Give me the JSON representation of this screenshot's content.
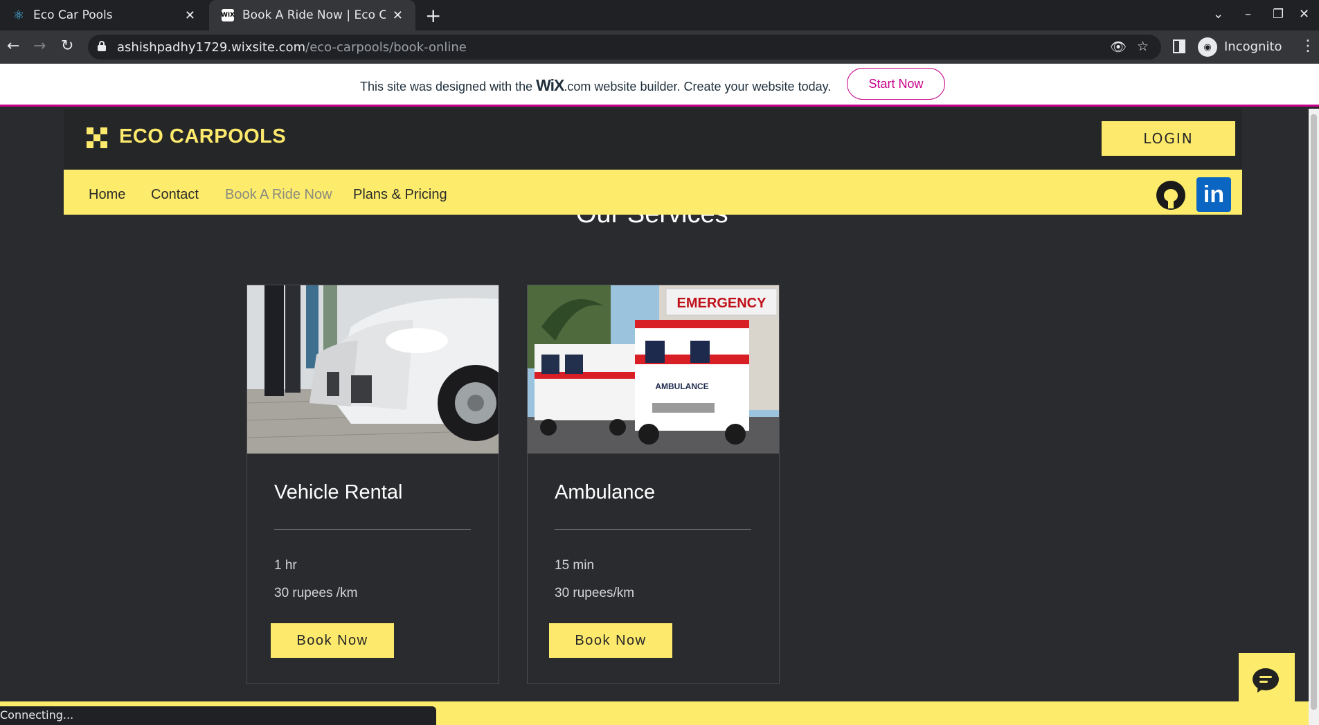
{
  "browser": {
    "tabs": [
      {
        "title": "Eco Car Pools",
        "icon": "react-icon"
      },
      {
        "title": "Book A Ride Now | Eco Car",
        "icon": "wix-icon",
        "icon_text": "WiX"
      }
    ],
    "url_host": "ashishpadhy1729.wixsite.com",
    "url_path": "/eco-carpools/book-online",
    "profile_label": "Incognito",
    "status_text": "Connecting..."
  },
  "wix_banner": {
    "text_before": "This site was designed with the",
    "logo": "WiX",
    "text_after": ".com website builder. Create your website today.",
    "cta": "Start Now"
  },
  "site": {
    "logo_text": "ECO CARPOOLS",
    "login_label": "LOGIN",
    "nav": [
      {
        "label": "Home"
      },
      {
        "label": "Contact"
      },
      {
        "label": "Book A Ride Now",
        "active": true
      },
      {
        "label": "Plans & Pricing"
      }
    ],
    "social": [
      "github-icon",
      "linkedin-icon"
    ],
    "linkedin_text": "in"
  },
  "main": {
    "section_title": "Our Services",
    "services": [
      {
        "name": "Vehicle Rental",
        "duration": "1 hr",
        "price": "30 rupees /km",
        "button": "Book Now",
        "image": "cars-photo"
      },
      {
        "name": "Ambulance",
        "duration": "15 min",
        "price": "30 rupees/km",
        "button": "Book Now",
        "image": "ambulance-photo",
        "image_texts": [
          "EMERGENCY",
          "AMBULANCE"
        ]
      }
    ]
  },
  "colors": {
    "accent": "#fde96b",
    "background": "#2a2b2f",
    "wix_magenta": "#c7008a",
    "linkedin_blue": "#0a66c2"
  }
}
